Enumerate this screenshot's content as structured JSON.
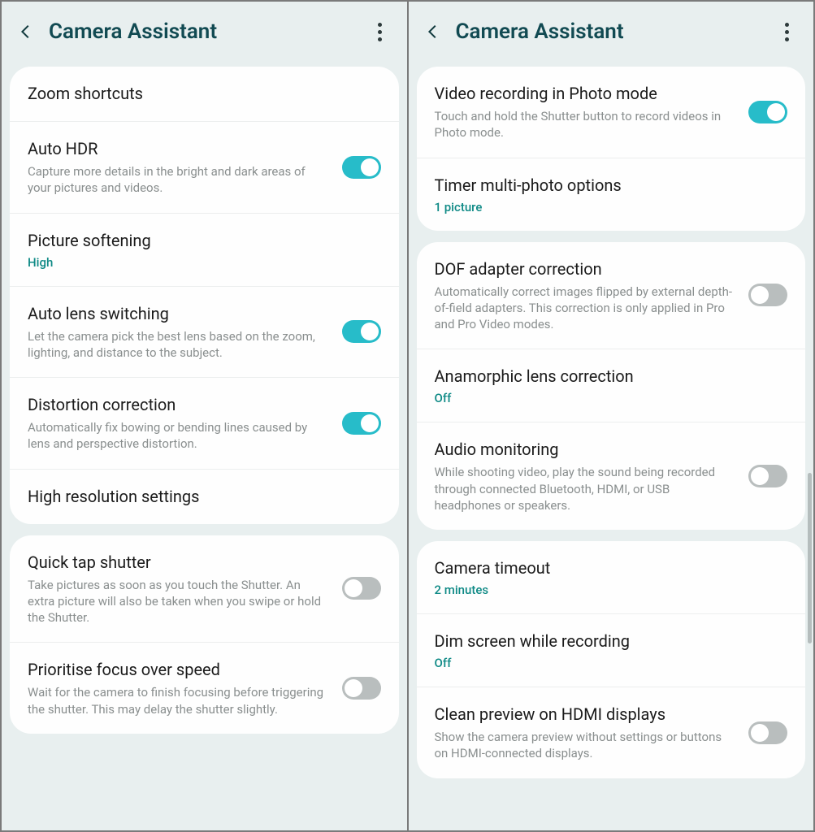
{
  "left": {
    "title": "Camera Assistant",
    "groups": [
      {
        "items": [
          {
            "title": "Zoom shortcuts"
          },
          {
            "title": "Auto HDR",
            "desc": "Capture more details in the bright and dark areas of your pictures and videos.",
            "toggle": true
          },
          {
            "title": "Picture softening",
            "value": "High"
          },
          {
            "title": "Auto lens switching",
            "desc": "Let the camera pick the best lens based on the zoom, lighting, and distance to the subject.",
            "toggle": true
          },
          {
            "title": "Distortion correction",
            "desc": "Automatically fix bowing or bending lines caused by lens and perspective distortion.",
            "toggle": true
          },
          {
            "title": "High resolution settings"
          }
        ]
      },
      {
        "items": [
          {
            "title": "Quick tap shutter",
            "desc": "Take pictures as soon as you touch the Shutter. An extra picture will also be taken when you swipe or hold the Shutter.",
            "toggle": false
          },
          {
            "title": "Prioritise focus over speed",
            "desc": "Wait for the camera to finish focusing before triggering the shutter. This may delay the shutter slightly.",
            "toggle": false
          }
        ]
      }
    ]
  },
  "right": {
    "title": "Camera Assistant",
    "groups": [
      {
        "items": [
          {
            "title": "Video recording in Photo mode",
            "desc": "Touch and hold the Shutter button to record videos in Photo mode.",
            "toggle": true
          },
          {
            "title": "Timer multi-photo options",
            "value": "1 picture"
          }
        ]
      },
      {
        "items": [
          {
            "title": "DOF adapter correction",
            "desc": "Automatically correct images flipped by external depth-of-field adapters. This correction is only applied in Pro and Pro Video modes.",
            "toggle": false
          },
          {
            "title": "Anamorphic lens correction",
            "value": "Off"
          },
          {
            "title": "Audio monitoring",
            "desc": "While shooting video, play the sound being recorded through connected Bluetooth, HDMI, or USB headphones or speakers.",
            "toggle": false
          }
        ]
      },
      {
        "items": [
          {
            "title": "Camera timeout",
            "value": "2 minutes"
          },
          {
            "title": "Dim screen while recording",
            "value": "Off"
          },
          {
            "title": "Clean preview on HDMI displays",
            "desc": "Show the camera preview without settings or buttons on HDMI-connected displays.",
            "toggle": false
          }
        ]
      }
    ]
  }
}
